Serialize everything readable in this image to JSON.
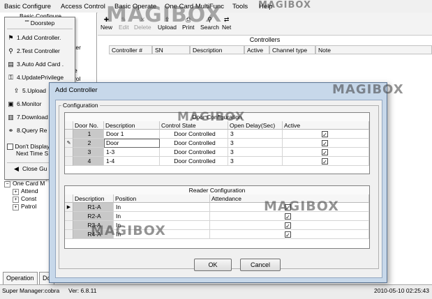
{
  "menubar": {
    "items": [
      "Basic Configure",
      "Access Control",
      "Basic Operate",
      "One Card MultiFunc",
      "Tools",
      "Help"
    ]
  },
  "toolbar": {
    "buttons": [
      "New",
      "Edit",
      "Delete",
      "Upload",
      "Print",
      "Search",
      "Net"
    ]
  },
  "controllers_grid": {
    "title": "Controllers",
    "columns": [
      "Controller #",
      "SN",
      "Description",
      "Active",
      "Channel type",
      "Note"
    ]
  },
  "left_tree": {
    "root": "Basic Configure",
    "partial_labels": [
      "ter",
      "e",
      "rol"
    ],
    "partial_item": "...ueny ...",
    "one_card_node": "One Card M",
    "children": [
      "Attend",
      "Const",
      "Patrol"
    ]
  },
  "doorstep": {
    "title": "Doorstep",
    "items": [
      "1.Add Controller.",
      "2.Test Controller",
      "3.Auto Add Card .",
      "4.UpdatePrivilege",
      "5.Upload",
      "6.Monitor",
      "7.Download",
      "8.Query Re"
    ],
    "checkbox_label_1": "Don't Display",
    "checkbox_label_2": "Next Time S",
    "close_label": "Close Gu"
  },
  "bottom_tabs": [
    "Operation",
    "Do"
  ],
  "statusbar": {
    "user": "Super Manager:cobra",
    "version": "Ver: 6.8.11",
    "datetime": "2010-05-10 02:25:43"
  },
  "dialog": {
    "title": "Add Controller",
    "configuration_label": "Configuration",
    "door_config": {
      "title": "Door Configuration",
      "columns": [
        "Door No.",
        "Description",
        "Control State",
        "Open Delay(Sec)",
        "Active"
      ],
      "rows": [
        {
          "no": "1",
          "desc": "Door 1",
          "state": "Door Controlled",
          "delay": "3",
          "active": true
        },
        {
          "no": "2",
          "desc": "Door",
          "state": "Door Controlled",
          "delay": "3",
          "active": true
        },
        {
          "no": "3",
          "desc": "1-3",
          "state": "Door Controlled",
          "delay": "3",
          "active": true
        },
        {
          "no": "4",
          "desc": "1-4",
          "state": "Door Controlled",
          "delay": "3",
          "active": true
        }
      ]
    },
    "reader_config": {
      "title": "Reader Configuration",
      "columns": [
        "Description",
        "Position",
        "Attendance"
      ],
      "rows": [
        {
          "desc": "R1-A",
          "pos": "In",
          "att": true
        },
        {
          "desc": "R2-A",
          "pos": "In",
          "att": true
        },
        {
          "desc": "R3-A",
          "pos": "In",
          "att": true
        },
        {
          "desc": "R4-A",
          "pos": "In",
          "att": true
        }
      ]
    },
    "ok_label": "OK",
    "cancel_label": "Cancel"
  },
  "watermarks": [
    "MAGIBOX",
    "MAGIBOX",
    "MAGIBOX",
    "MAGIBOX",
    "MAGIBOX",
    "MAGIBOX"
  ],
  "colors": {
    "dialog_frame": "#c7d8ea",
    "gray_cell": "#c8c8c8"
  }
}
